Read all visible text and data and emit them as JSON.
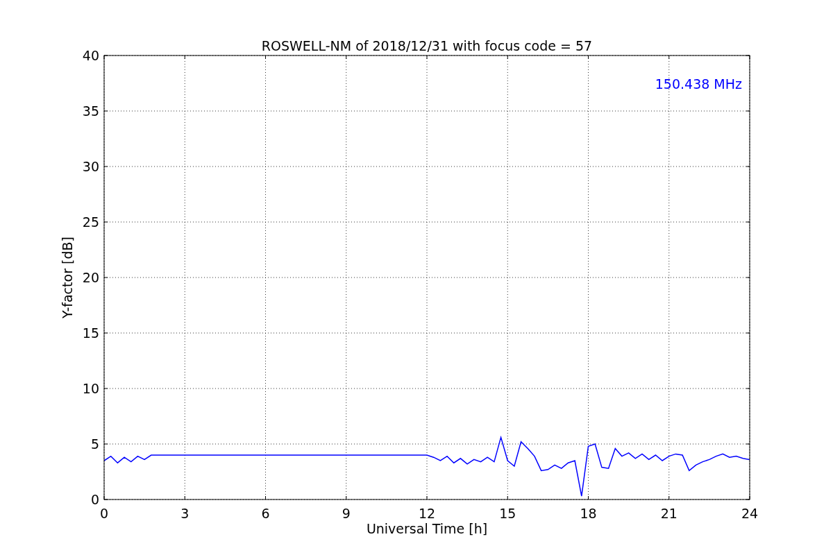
{
  "figure": {
    "chart_data": {
      "type": "line",
      "title": "ROSWELL-NM of 2018/12/31 with focus code = 57",
      "xlabel": "Universal Time [h]",
      "ylabel": "Y-factor [dB]",
      "xlim": [
        0,
        24
      ],
      "ylim": [
        0,
        40
      ],
      "xticks": [
        0,
        3,
        6,
        9,
        12,
        15,
        18,
        21,
        24
      ],
      "yticks": [
        0,
        5,
        10,
        15,
        20,
        25,
        30,
        35,
        40
      ],
      "x": [
        0,
        0.25,
        0.5,
        0.75,
        1,
        1.25,
        1.5,
        1.75,
        2,
        2.25,
        2.5,
        2.75,
        3,
        3.25,
        3.5,
        3.75,
        4,
        4.25,
        4.5,
        4.75,
        5,
        5.25,
        5.5,
        5.75,
        6,
        6.25,
        6.5,
        6.75,
        7,
        7.25,
        7.5,
        7.75,
        8,
        8.25,
        8.5,
        8.75,
        9,
        9.25,
        9.5,
        9.75,
        10,
        10.25,
        10.5,
        10.75,
        11,
        11.25,
        11.5,
        11.75,
        12,
        12.25,
        12.5,
        12.75,
        13,
        13.25,
        13.5,
        13.75,
        14,
        14.25,
        14.5,
        14.75,
        15,
        15.25,
        15.5,
        15.75,
        16,
        16.25,
        16.5,
        16.75,
        17,
        17.25,
        17.5,
        17.75,
        18,
        18.25,
        18.5,
        18.75,
        19,
        19.25,
        19.5,
        19.75,
        20,
        20.25,
        20.5,
        20.75,
        21,
        21.25,
        21.5,
        21.75,
        22,
        22.25,
        22.5,
        22.75,
        23,
        23.25,
        23.5,
        23.75,
        24
      ],
      "series": [
        {
          "color": "#0000ff",
          "values": [
            3.5,
            3.9,
            3.3,
            3.8,
            3.4,
            3.9,
            3.6,
            4,
            4,
            4,
            4,
            4,
            4,
            4,
            4,
            4,
            4,
            4,
            4,
            4,
            4,
            4,
            4,
            4,
            4,
            4,
            4,
            4,
            4,
            4,
            4,
            4,
            4,
            4,
            4,
            4,
            4,
            4,
            4,
            4,
            4,
            4,
            4,
            4,
            4,
            4,
            4,
            4,
            4,
            3.8,
            3.5,
            3.9,
            3.3,
            3.7,
            3.2,
            3.6,
            3.4,
            3.8,
            3.4,
            5.6,
            3.5,
            3.0,
            5.2,
            4.6,
            3.9,
            2.6,
            2.7,
            3.1,
            2.8,
            3.3,
            3.5,
            0.3,
            4.8,
            5.0,
            2.9,
            2.8,
            4.6,
            3.9,
            4.2,
            3.7,
            4.1,
            3.6,
            4.0,
            3.5,
            3.9,
            4.1,
            4.0,
            2.6,
            3.1,
            3.4,
            3.6,
            3.9,
            4.1,
            3.8,
            3.9,
            3.7,
            3.6
          ]
        }
      ],
      "grid": true,
      "annotations": [
        {
          "text": "150.438 MHz"
        }
      ]
    }
  }
}
